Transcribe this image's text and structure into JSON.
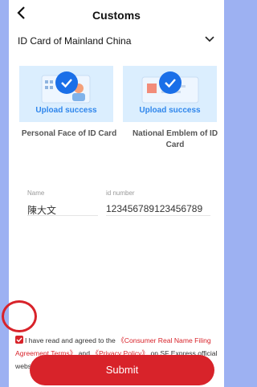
{
  "header": {
    "title": "Customs",
    "back_icon": "chevron-left-icon"
  },
  "document_type": {
    "value": "ID Card of Mainland China"
  },
  "uploads": [
    {
      "status": "Upload success",
      "caption": "Personal Face of ID Card"
    },
    {
      "status": "Upload success",
      "caption": "National Emblem of ID Card"
    }
  ],
  "form": {
    "name_label": "Name",
    "name_value": "陳大文",
    "id_label": "id number",
    "id_value": "123456789123456789"
  },
  "agreement": {
    "prefix": "I have read and agreed to the ",
    "link1": "《Consumer Real Name Filing Agreement Terms》",
    "and": " and ",
    "link2": "《Privacy Policy》",
    "suffix": " on SF Express official website."
  },
  "submit_label": "Submit",
  "colors": {
    "accent": "#d8232a",
    "upload_blue": "#2f86ec",
    "card_bg": "#dbeefe",
    "check_blue": "#1a6fe8"
  }
}
